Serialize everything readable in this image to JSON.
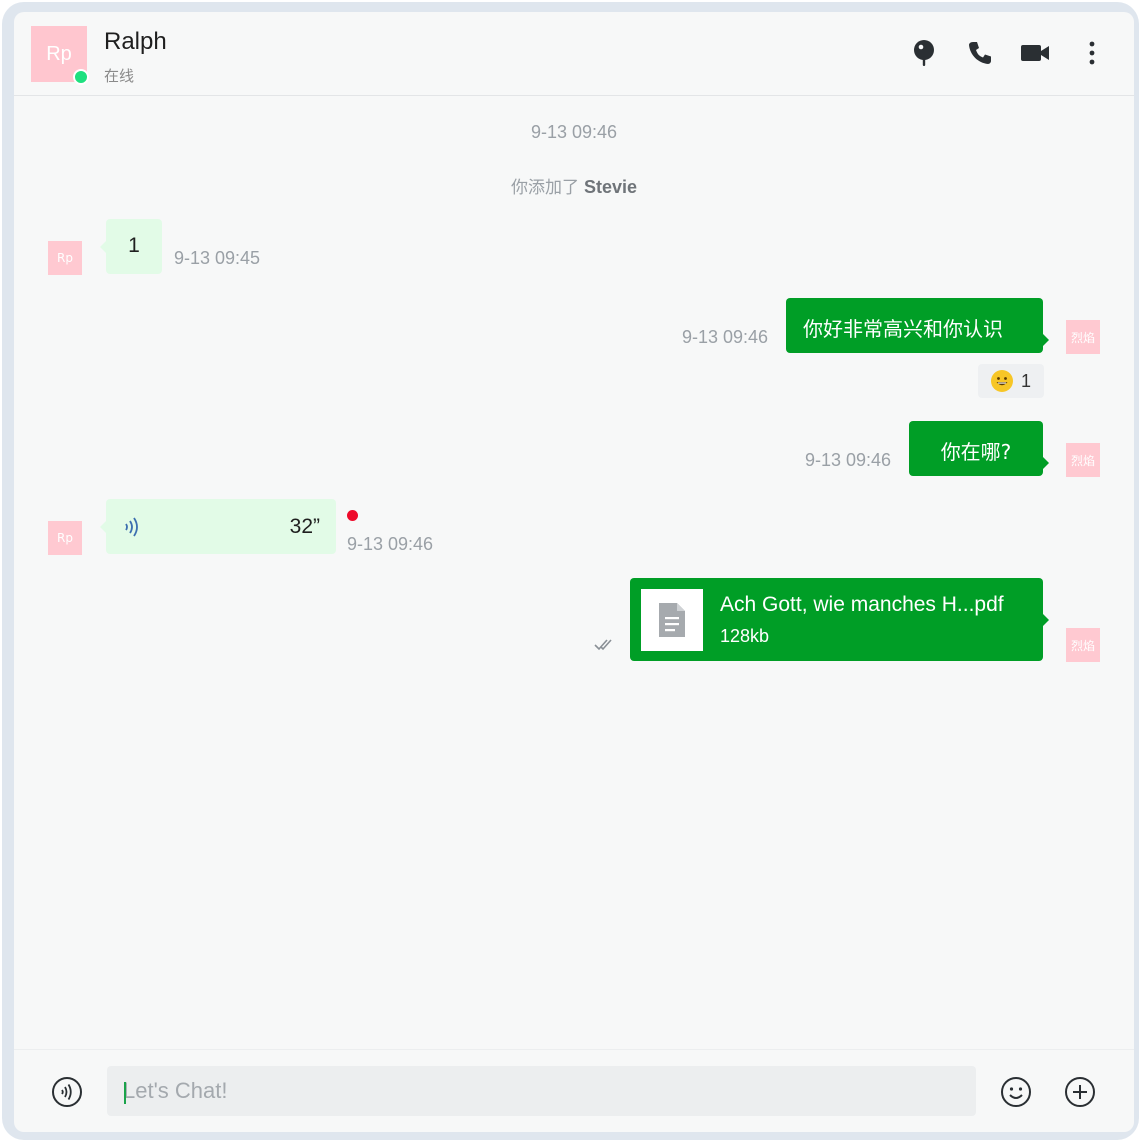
{
  "header": {
    "avatar_text": "Rp",
    "contact_name": "Ralph",
    "contact_status": "在线",
    "icons": [
      "pin-icon",
      "phone-icon",
      "video-icon",
      "more-icon"
    ]
  },
  "timeline": {
    "top_timestamp": "9-13 09:46",
    "system_message_prefix": "你添加了",
    "system_message_name": "Stevie"
  },
  "messages": [
    {
      "direction": "in",
      "avatar_text": "Rp",
      "type": "text",
      "text": "1",
      "time": "9-13 09:45"
    },
    {
      "direction": "out",
      "avatar_text": "烈焰",
      "type": "text",
      "text": "你好非常高兴和你认识",
      "time": "9-13 09:46",
      "reaction": {
        "emoji": "grinning-face",
        "count": "1"
      }
    },
    {
      "direction": "out",
      "avatar_text": "烈焰",
      "type": "text",
      "text": "你在哪?",
      "time": "9-13 09:46"
    },
    {
      "direction": "in",
      "avatar_text": "Rp",
      "type": "voice",
      "duration": "32”",
      "time": "9-13 09:46",
      "unread": true
    },
    {
      "direction": "out",
      "avatar_text": "烈焰",
      "type": "file",
      "file_name": "Ach Gott, wie manches H...pdf",
      "file_size": "128kb",
      "read_status": "double-check-icon"
    }
  ],
  "input": {
    "placeholder": "Let's Chat!",
    "icons": [
      "voice-icon",
      "emoji-icon",
      "add-icon"
    ]
  },
  "colors": {
    "outgoing_bubble": "#009e26",
    "incoming_bubble": "#e2fbe7",
    "avatar_pink": "#ffc6cf",
    "online": "#1ee07f",
    "unread": "#ee0a2a"
  }
}
